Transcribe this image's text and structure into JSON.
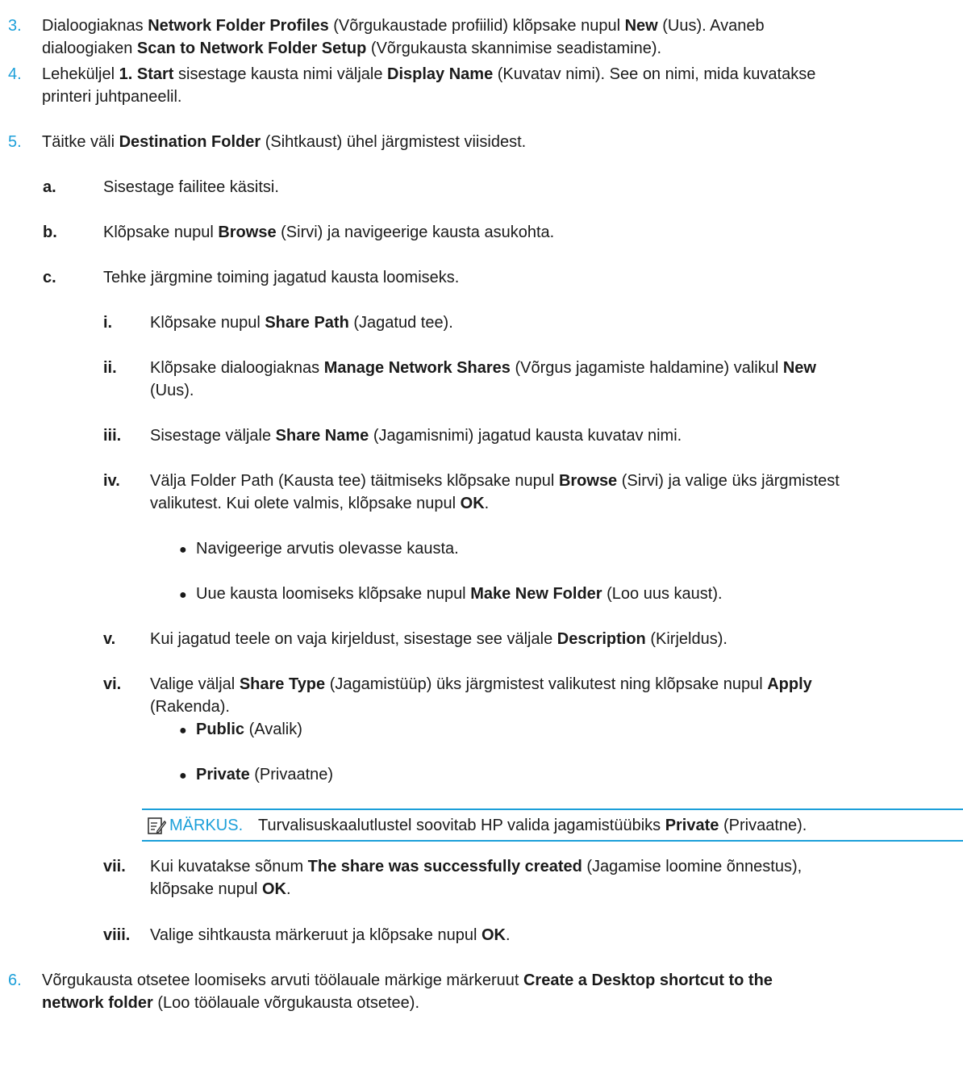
{
  "steps": [
    {
      "marker": "3.",
      "lines": [
        [
          {
            "t": "Dialoogiaknas "
          },
          {
            "t": "Network Folder Profiles",
            "b": true
          },
          {
            "t": " (Võrgukaustade profiilid) klõpsake nupul "
          },
          {
            "t": "New",
            "b": true
          },
          {
            "t": " (Uus). Avaneb"
          }
        ],
        [
          {
            "t": "dialoogiaken "
          },
          {
            "t": "Scan to Network Folder Setup",
            "b": true
          },
          {
            "t": " (Võrgukausta skannimise seadistamine)."
          }
        ]
      ]
    },
    {
      "marker": "4.",
      "lines": [
        [
          {
            "t": "Leheküljel "
          },
          {
            "t": "1. Start",
            "b": true
          },
          {
            "t": " sisestage kausta nimi väljale "
          },
          {
            "t": "Display Name",
            "b": true
          },
          {
            "t": " (Kuvatav nimi). See on nimi, mida kuvatakse"
          }
        ],
        [
          {
            "t": "printeri juhtpaneelil."
          }
        ]
      ]
    },
    {
      "marker": "5.",
      "lines": [
        [
          {
            "t": "Täitke väli "
          },
          {
            "t": "Destination Folder",
            "b": true
          },
          {
            "t": " (Sihtkaust) ühel järgmistest viisidest."
          }
        ]
      ]
    },
    {
      "marker": "a.",
      "lines": [
        [
          {
            "t": "Sisestage failitee käsitsi."
          }
        ]
      ]
    },
    {
      "marker": "b.",
      "lines": [
        [
          {
            "t": "Klõpsake nupul "
          },
          {
            "t": "Browse",
            "b": true
          },
          {
            "t": " (Sirvi) ja navigeerige kausta asukohta."
          }
        ]
      ]
    },
    {
      "marker": "c.",
      "lines": [
        [
          {
            "t": "Tehke järgmine toiming jagatud kausta loomiseks."
          }
        ]
      ]
    },
    {
      "marker": "i.",
      "lines": [
        [
          {
            "t": "Klõpsake nupul "
          },
          {
            "t": "Share Path",
            "b": true
          },
          {
            "t": " (Jagatud tee)."
          }
        ]
      ]
    },
    {
      "marker": "ii.",
      "lines": [
        [
          {
            "t": "Klõpsake dialoogiaknas "
          },
          {
            "t": "Manage Network Shares",
            "b": true
          },
          {
            "t": " (Võrgus jagamiste haldamine) valikul "
          },
          {
            "t": "New",
            "b": true
          }
        ],
        [
          {
            "t": "(Uus)."
          }
        ]
      ]
    },
    {
      "marker": "iii.",
      "lines": [
        [
          {
            "t": "Sisestage väljale "
          },
          {
            "t": "Share Name",
            "b": true
          },
          {
            "t": " (Jagamisnimi) jagatud kausta kuvatav nimi."
          }
        ]
      ]
    },
    {
      "marker": "iv.",
      "lines": [
        [
          {
            "t": "Välja Folder Path (Kausta tee) täitmiseks klõpsake nupul "
          },
          {
            "t": "Browse",
            "b": true
          },
          {
            "t": " (Sirvi) ja valige üks järgmistest"
          }
        ],
        [
          {
            "t": "valikutest. Kui olete valmis, klõpsake nupul "
          },
          {
            "t": "OK",
            "b": true
          },
          {
            "t": "."
          }
        ]
      ]
    },
    {
      "marker": "●",
      "lines": [
        [
          {
            "t": "Navigeerige arvutis olevasse kausta."
          }
        ]
      ]
    },
    {
      "marker": "●",
      "lines": [
        [
          {
            "t": "Uue kausta loomiseks klõpsake nupul "
          },
          {
            "t": "Make New Folder",
            "b": true
          },
          {
            "t": " (Loo uus kaust)."
          }
        ]
      ]
    },
    {
      "marker": "v.",
      "lines": [
        [
          {
            "t": "Kui jagatud teele on vaja kirjeldust, sisestage see väljale "
          },
          {
            "t": "Description",
            "b": true
          },
          {
            "t": " (Kirjeldus)."
          }
        ]
      ]
    },
    {
      "marker": "vi.",
      "lines": [
        [
          {
            "t": "Valige väljal "
          },
          {
            "t": "Share Type",
            "b": true
          },
          {
            "t": " (Jagamistüüp) üks järgmistest valikutest ning klõpsake nupul "
          },
          {
            "t": "Apply",
            "b": true
          }
        ],
        [
          {
            "t": "(Rakenda)."
          }
        ]
      ]
    },
    {
      "marker": "●",
      "lines": [
        [
          {
            "t": "Public",
            "b": true
          },
          {
            "t": " (Avalik)"
          }
        ]
      ]
    },
    {
      "marker": "●",
      "lines": [
        [
          {
            "t": "Private",
            "b": true
          },
          {
            "t": " (Privaatne)"
          }
        ]
      ]
    },
    {
      "marker": "vii.",
      "lines": [
        [
          {
            "t": "Kui kuvatakse sõnum "
          },
          {
            "t": "The share was successfully created",
            "b": true
          },
          {
            "t": " (Jagamise loomine õnnestus),"
          }
        ],
        [
          {
            "t": "klõpsake nupul "
          },
          {
            "t": "OK",
            "b": true
          },
          {
            "t": "."
          }
        ]
      ]
    },
    {
      "marker": "viii.",
      "lines": [
        [
          {
            "t": "Valige sihtkausta märkeruut ja klõpsake nupul "
          },
          {
            "t": "OK",
            "b": true
          },
          {
            "t": "."
          }
        ]
      ]
    },
    {
      "marker": "6.",
      "lines": [
        [
          {
            "t": "Võrgukausta otsetee loomiseks arvuti töölauale märkige märkeruut "
          },
          {
            "t": "Create a Desktop shortcut to the",
            "b": true
          }
        ],
        [
          {
            "t": "network folder",
            "b": true
          },
          {
            "t": " (Loo töölauale võrgukausta otsetee)."
          }
        ]
      ]
    }
  ],
  "note": {
    "icon": "note-pencil-icon",
    "label": "MÄRKUS.",
    "text": [
      {
        "t": "Turvalisuskaalutlustel soovitab HP valida jagamistüübiks "
      },
      {
        "t": "Private",
        "b": true
      },
      {
        "t": " (Privaatne)."
      }
    ]
  },
  "colors": {
    "accent": "#1b9fd9",
    "text": "#1a1a1a"
  }
}
